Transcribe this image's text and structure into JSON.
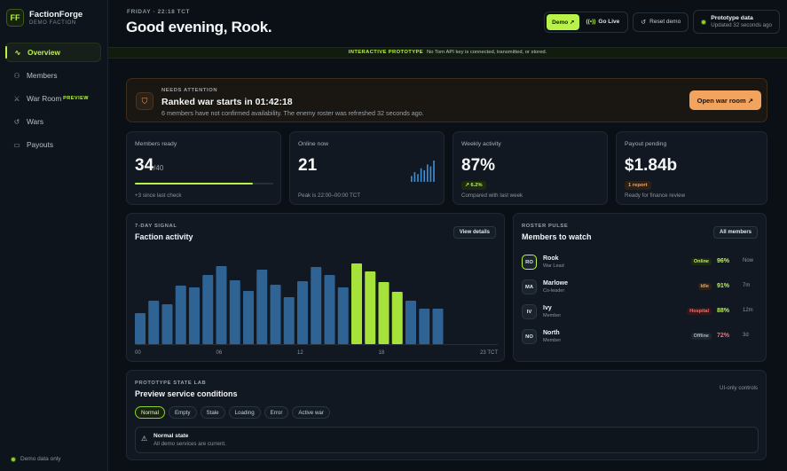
{
  "brand": {
    "logo": "FF",
    "name": "FactionForge",
    "sub": "DEMO FACTION"
  },
  "sidebar": {
    "items": [
      {
        "label": "Overview",
        "icon": "activity-icon",
        "glyph": "∿"
      },
      {
        "label": "Members",
        "icon": "users-icon",
        "glyph": "⚇"
      },
      {
        "label": "War Room",
        "icon": "crossed-swords-icon",
        "glyph": "⚔",
        "badge": "PREVIEW"
      },
      {
        "label": "Wars",
        "icon": "history-icon",
        "glyph": "↺"
      },
      {
        "label": "Payouts",
        "icon": "wallet-icon",
        "glyph": "▭"
      }
    ],
    "footer": "Demo data only"
  },
  "header": {
    "eyebrow": "FRIDAY · 22:18 TCT",
    "greeting": "Good evening, Rook.",
    "demo_label": "Demo ↗",
    "live_label": "Go Live",
    "reset_label": "Reset demo",
    "proto_title": "Prototype data",
    "proto_sub": "Updated 32 seconds ago"
  },
  "banner": {
    "tag": "INTERACTIVE PROTOTYPE",
    "text": "No Torn API key is connected, transmitted, or stored."
  },
  "attention": {
    "label": "NEEDS ATTENTION",
    "title": "Ranked war starts in 01:42:18",
    "desc": "6 members have not confirmed availability. The enemy roster was refreshed 32 seconds ago.",
    "button": "Open war room ↗"
  },
  "stats": {
    "members": {
      "label": "Members ready",
      "value": "34",
      "total": "/40",
      "ready": 34,
      "of": 40,
      "foot": "+3 since last check"
    },
    "online": {
      "label": "Online now",
      "value": "21",
      "foot": "Peak is 22:00–00:00 TCT",
      "spark": [
        3,
        5,
        4,
        7,
        6,
        9,
        8,
        11
      ]
    },
    "weekly": {
      "label": "Weekly activity",
      "value": "87%",
      "chip": "↗ 6.2%",
      "foot": "Compared with last week"
    },
    "payout": {
      "label": "Payout pending",
      "value": "$1.84b",
      "chip": "1 report",
      "foot": "Ready for finance review"
    }
  },
  "activity": {
    "eyebrow": "7-DAY SIGNAL",
    "title": "Faction activity",
    "button": "View details",
    "accent": "#a6e23a",
    "base": "#2f6393"
  },
  "chart_data": {
    "type": "bar",
    "categories": [
      "00",
      "01",
      "02",
      "03",
      "04",
      "05",
      "06",
      "07",
      "08",
      "09",
      "10",
      "11",
      "12",
      "13",
      "14",
      "15",
      "16",
      "17",
      "18",
      "19",
      "20",
      "21",
      "22",
      "23"
    ],
    "tick_labels": [
      "00",
      "06",
      "12",
      "18",
      "23 TCT"
    ],
    "values": [
      35,
      49,
      45,
      66,
      64,
      78,
      88,
      72,
      60,
      84,
      67,
      53,
      71,
      87,
      78,
      64,
      91,
      82,
      70,
      59,
      49,
      40,
      40,
      0
    ],
    "highlight": [
      16,
      17,
      18,
      19
    ],
    "ylim": [
      0,
      100
    ],
    "grid": false,
    "legend": "none"
  },
  "pulse": {
    "eyebrow": "ROSTER PULSE",
    "title": "Members to watch",
    "button": "All members",
    "members": [
      {
        "initials": "RO",
        "name": "Rook",
        "role": "War Lead",
        "status": "Online",
        "pct": "96%",
        "time": "Now",
        "status_fg": "#b9f34a",
        "status_bg": "#1c2a12",
        "pct_color": "#b9f34a"
      },
      {
        "initials": "MA",
        "name": "Marlowe",
        "role": "Co-leader",
        "status": "Idle",
        "pct": "91%",
        "time": "7m",
        "status_fg": "#f0a35a",
        "status_bg": "#2e2014",
        "pct_color": "#b9f34a"
      },
      {
        "initials": "IV",
        "name": "Ivy",
        "role": "Member",
        "status": "Hospital",
        "pct": "88%",
        "time": "12m",
        "status_fg": "#ff6b6b",
        "status_bg": "#35171a",
        "pct_color": "#b9f34a"
      },
      {
        "initials": "NO",
        "name": "North",
        "role": "Member",
        "status": "Offline",
        "pct": "72%",
        "time": "3d",
        "status_fg": "#aab3bc",
        "status_bg": "#1d252e",
        "pct_color": "#ff6b6b"
      }
    ]
  },
  "lab": {
    "eyebrow": "PROTOTYPE STATE LAB",
    "title": "Preview service conditions",
    "right": "UI-only controls",
    "pills": [
      "Normal",
      "Empty",
      "Stale",
      "Loading",
      "Error",
      "Active war"
    ],
    "state_title": "Normal state",
    "state_desc": "All demo services are current."
  }
}
